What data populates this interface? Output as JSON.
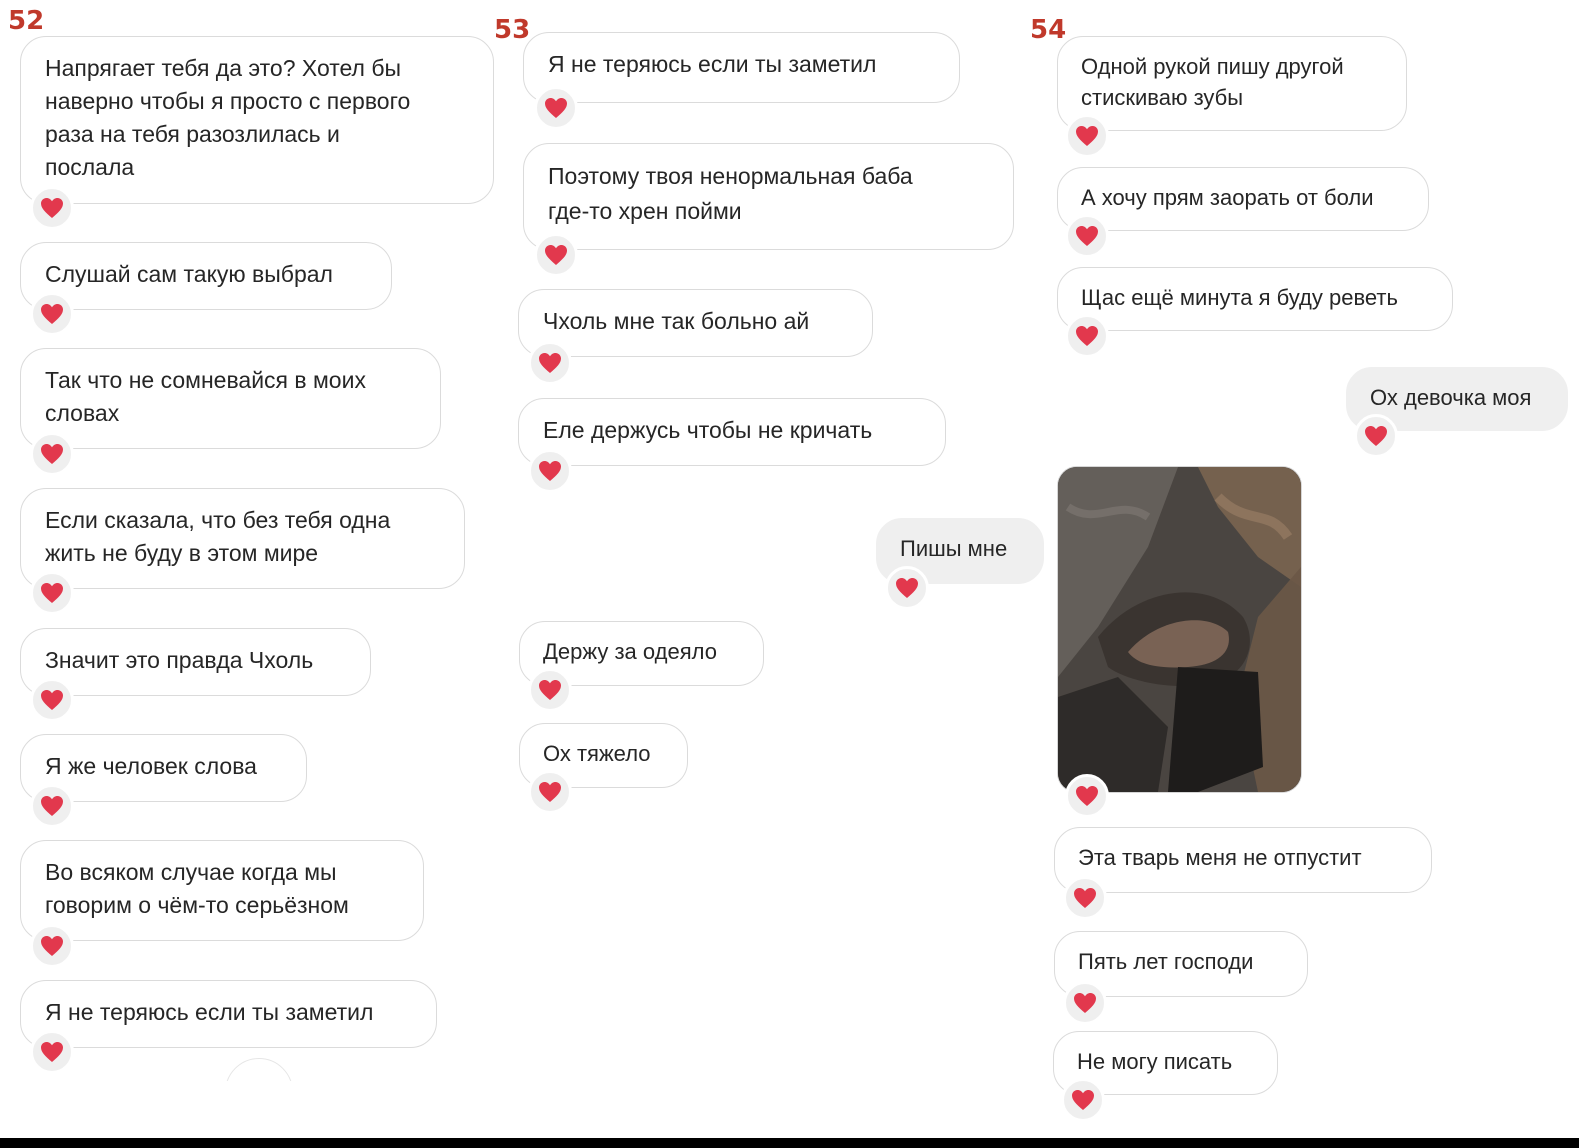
{
  "pages": {
    "p52": "52",
    "p53": "53",
    "p54": "54"
  },
  "colors": {
    "page_number": "#c0392b",
    "heart": "#e2384d",
    "incoming_border": "#dbdbdb",
    "outgoing_bg": "#efefef"
  },
  "col52": [
    "Напрягает тебя да это? Хотел бы\nнаверно чтобы я просто с первого\nраза на тебя разозлилась и\nпослала",
    "Слушай сам такую выбрал",
    "Так что не сомневайся в моих\nсловах",
    "Если сказала, что без тебя одна\nжить не буду в этом мире",
    "Значит это правда Чхоль",
    "Я же человек слова",
    "Во всяком случае когда мы\nговорим о чём-то серьёзном",
    "Я не теряюсь если ты заметил"
  ],
  "col53": [
    "Я не теряюсь если ты заметил",
    "Поэтому твоя ненормальная баба\nгде-то хрен пойми",
    "Чхоль мне так больно ай",
    "Еле держусь чтобы не кричать",
    "Пишы мне",
    "Держу за одеяло",
    "Ох тяжело"
  ],
  "col54": [
    "Одной рукой пишу другой\nстискиваю зубы",
    "А хочу прям заорать от боли",
    "Щас ещё минута я буду реветь",
    "Ох девочка моя",
    "Эта тварь меня не отпустит",
    "Пять лет господи",
    "Не могу писать"
  ],
  "icons": {
    "reaction": "heart-icon",
    "photo": "photo-attachment"
  }
}
